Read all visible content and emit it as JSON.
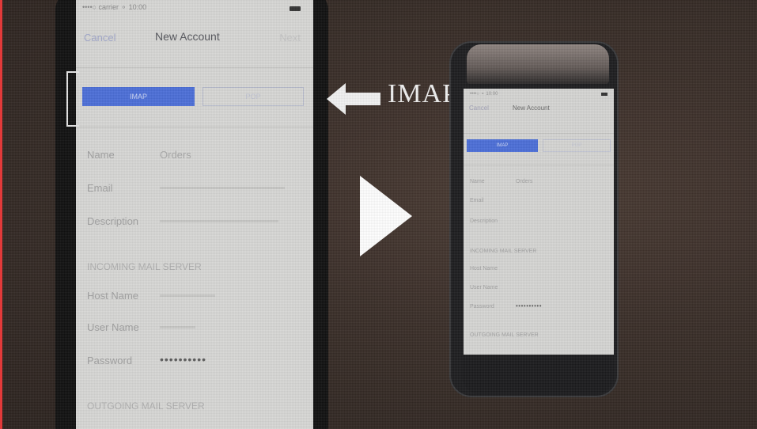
{
  "overlay": {
    "arrow_label": "IMAP",
    "play_icon": "play-icon"
  },
  "big_phone": {
    "nav": {
      "cancel": "Cancel",
      "title": "New Account",
      "next": "Next"
    },
    "segments": {
      "imap": "IMAP",
      "pop": "POP"
    },
    "fields": [
      {
        "label": "Name",
        "value": "Orders"
      },
      {
        "label": "Email",
        "value": ""
      },
      {
        "label": "Description",
        "value": ""
      }
    ],
    "incoming_header": "INCOMING MAIL SERVER",
    "server_fields": [
      {
        "label": "Host Name",
        "value": ""
      },
      {
        "label": "User Name",
        "value": ""
      },
      {
        "label": "Password",
        "value": "••••••••••"
      }
    ],
    "outgoing_header": "OUTGOING MAIL SERVER"
  },
  "small_phone": {
    "nav": {
      "cancel": "Cancel",
      "title": "New Account"
    },
    "segments": {
      "imap": "IMAP",
      "pop": "POP"
    },
    "fields": [
      {
        "label": "Name",
        "value": "Orders"
      },
      {
        "label": "Email",
        "value": ""
      },
      {
        "label": "Description",
        "value": ""
      }
    ],
    "incoming_header": "INCOMING MAIL SERVER",
    "server_fields": [
      {
        "label": "Host Name",
        "value": ""
      },
      {
        "label": "User Name",
        "value": ""
      },
      {
        "label": "Password",
        "value": "••••••••••"
      }
    ],
    "outgoing_header": "OUTGOING MAIL SERVER"
  },
  "colors": {
    "background": "#3a2e28",
    "screen": "#d8d8d6",
    "segment_selected": "#4c6fd9",
    "arrow": "#f2f2f2"
  }
}
